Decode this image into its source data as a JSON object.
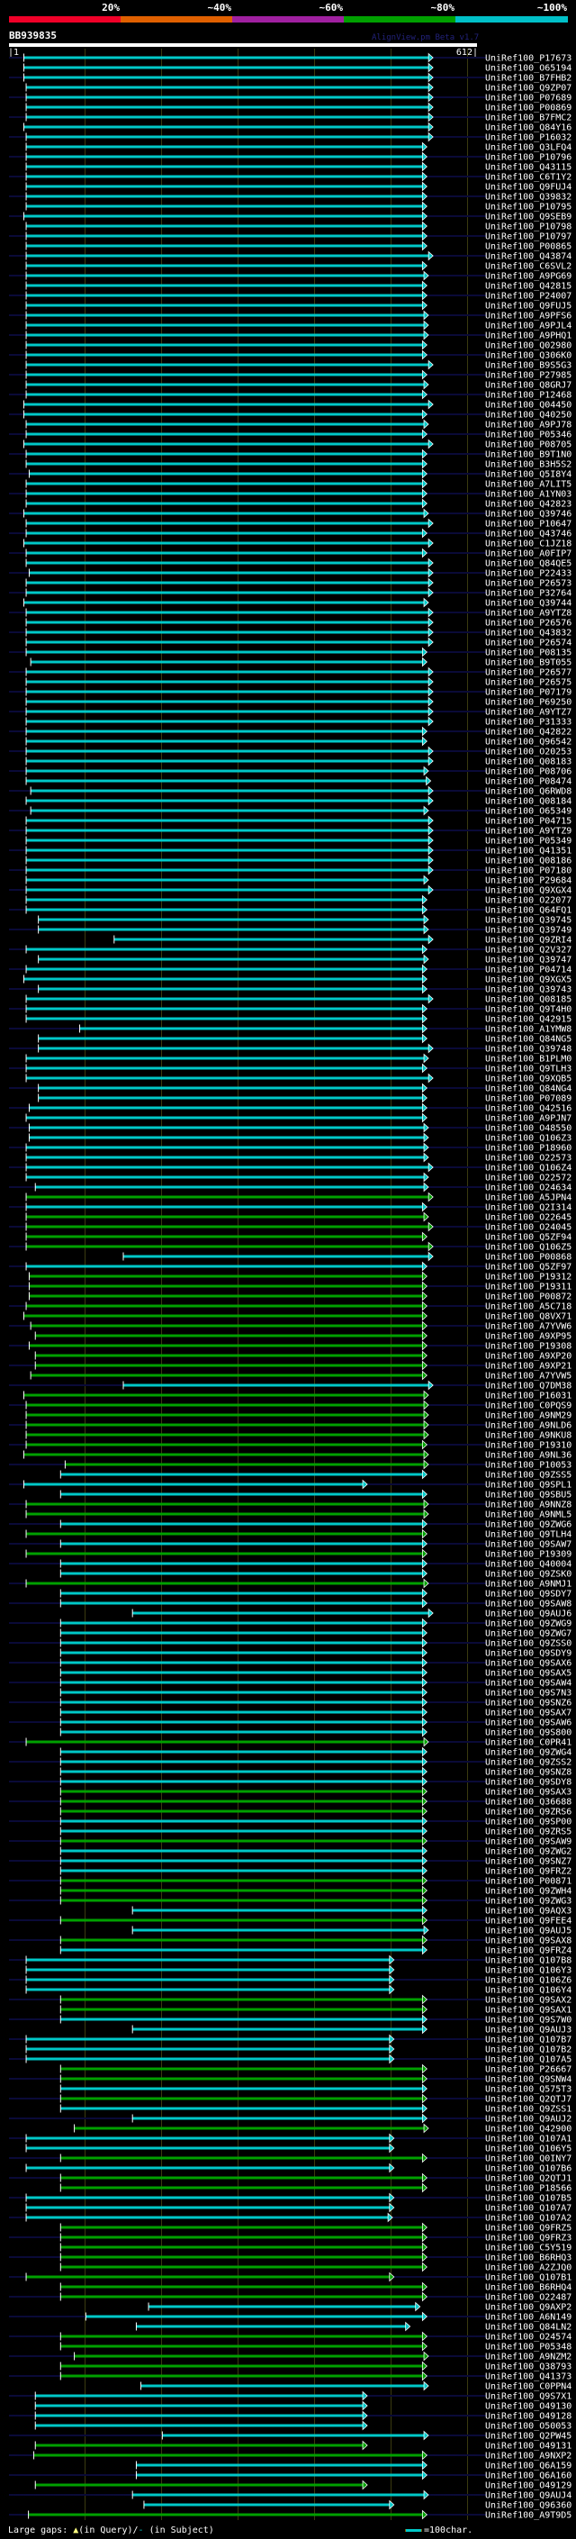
{
  "scale": {
    "labels": [
      "20%",
      "~40%",
      "~60%",
      "~80%",
      "~100%"
    ],
    "colors": [
      "#f00028",
      "#e06000",
      "#a020a0",
      "#00a000",
      "#00c0c8"
    ]
  },
  "query": {
    "name": "BB939835",
    "length_start": "|1",
    "length_end": "612|",
    "version": "AlignView.pm Beta v1.7",
    "length": 612
  },
  "bar_colors": {
    "c": "#00c8c8",
    "g": "#00a000",
    "stripe": "#0a0a38",
    "grid": "#3a3a10"
  },
  "footer": {
    "gaps_prefix": "Large gaps:",
    "gaps_query": "▲",
    "gaps_query_text": "(in Query)/",
    "gaps_subject": "-",
    "gaps_subject_text": " (in Subject)",
    "scale_text": "=100char."
  },
  "rows": [
    [
      "UniRef100_P17673",
      20,
      549,
      "c"
    ],
    [
      "UniRef100_O65194",
      20,
      549,
      "c"
    ],
    [
      "UniRef100_B7FHB2",
      20,
      549,
      "c"
    ],
    [
      "UniRef100_Q9ZP07",
      23,
      549,
      "c"
    ],
    [
      "UniRef100_P07689",
      23,
      549,
      "c"
    ],
    [
      "UniRef100_P00869",
      23,
      549,
      "c"
    ],
    [
      "UniRef100_B7FMC2",
      23,
      549,
      "c"
    ],
    [
      "UniRef100_Q84Y16",
      20,
      549,
      "c"
    ],
    [
      "UniRef100_P16032",
      23,
      549,
      "c"
    ],
    [
      "UniRef100_Q3LFQ4",
      23,
      541,
      "c"
    ],
    [
      "UniRef100_P10796",
      23,
      541,
      "c"
    ],
    [
      "UniRef100_Q43115",
      23,
      541,
      "c"
    ],
    [
      "UniRef100_C6T1Y2",
      23,
      541,
      "c"
    ],
    [
      "UniRef100_Q9FUJ4",
      23,
      541,
      "c"
    ],
    [
      "UniRef100_Q39832",
      23,
      541,
      "c"
    ],
    [
      "UniRef100_P10795",
      23,
      541,
      "c"
    ],
    [
      "UniRef100_Q9SEB9",
      20,
      541,
      "c"
    ],
    [
      "UniRef100_P10798",
      23,
      541,
      "c"
    ],
    [
      "UniRef100_P10797",
      23,
      541,
      "c"
    ],
    [
      "UniRef100_P00865",
      23,
      541,
      "c"
    ],
    [
      "UniRef100_Q43874",
      23,
      549,
      "c"
    ],
    [
      "UniRef100_C6SVL2",
      23,
      541,
      "c"
    ],
    [
      "UniRef100_A9PG69",
      23,
      543,
      "c"
    ],
    [
      "UniRef100_Q42815",
      23,
      541,
      "c"
    ],
    [
      "UniRef100_P24007",
      23,
      541,
      "c"
    ],
    [
      "UniRef100_Q9FUJ5",
      23,
      541,
      "c"
    ],
    [
      "UniRef100_A9PFS6",
      23,
      543,
      "c"
    ],
    [
      "UniRef100_A9PJL4",
      23,
      543,
      "c"
    ],
    [
      "UniRef100_A9PHQ1",
      23,
      543,
      "c"
    ],
    [
      "UniRef100_Q02980",
      23,
      541,
      "c"
    ],
    [
      "UniRef100_Q306K0",
      23,
      541,
      "c"
    ],
    [
      "UniRef100_B9S5G3",
      23,
      549,
      "c"
    ],
    [
      "UniRef100_P27985",
      23,
      541,
      "c"
    ],
    [
      "UniRef100_Q8GRJ7",
      23,
      543,
      "c"
    ],
    [
      "UniRef100_P12468",
      23,
      541,
      "c"
    ],
    [
      "UniRef100_Q04450",
      20,
      549,
      "c"
    ],
    [
      "UniRef100_Q40250",
      20,
      541,
      "c"
    ],
    [
      "UniRef100_A9PJ78",
      23,
      543,
      "c"
    ],
    [
      "UniRef100_P05346",
      23,
      541,
      "c"
    ],
    [
      "UniRef100_P08705",
      20,
      549,
      "c"
    ],
    [
      "UniRef100_B9T1N0",
      23,
      541,
      "c"
    ],
    [
      "UniRef100_B3H5S2",
      23,
      541,
      "c"
    ],
    [
      "UniRef100_Q5I8Y4",
      27,
      541,
      "c"
    ],
    [
      "UniRef100_A7LIT5",
      23,
      541,
      "c"
    ],
    [
      "UniRef100_A1YN03",
      23,
      541,
      "c"
    ],
    [
      "UniRef100_Q42823",
      23,
      541,
      "c"
    ],
    [
      "UniRef100_Q39746",
      20,
      543,
      "c"
    ],
    [
      "UniRef100_P10647",
      23,
      549,
      "c"
    ],
    [
      "UniRef100_Q43746",
      23,
      541,
      "c"
    ],
    [
      "UniRef100_C1JZ18",
      20,
      549,
      "c"
    ],
    [
      "UniRef100_A0FIP7",
      23,
      541,
      "c"
    ],
    [
      "UniRef100_Q84QE5",
      23,
      549,
      "c"
    ],
    [
      "UniRef100_P22433",
      27,
      549,
      "c"
    ],
    [
      "UniRef100_P26573",
      23,
      549,
      "c"
    ],
    [
      "UniRef100_P32764",
      23,
      549,
      "c"
    ],
    [
      "UniRef100_Q39744",
      20,
      543,
      "c"
    ],
    [
      "UniRef100_A9YTZ8",
      23,
      549,
      "c"
    ],
    [
      "UniRef100_P26576",
      23,
      549,
      "c"
    ],
    [
      "UniRef100_Q43832",
      23,
      549,
      "c"
    ],
    [
      "UniRef100_P26574",
      23,
      549,
      "c"
    ],
    [
      "UniRef100_P08135",
      23,
      541,
      "c"
    ],
    [
      "UniRef100_B9T055",
      29,
      541,
      "c"
    ],
    [
      "UniRef100_P26577",
      23,
      549,
      "c"
    ],
    [
      "UniRef100_P26575",
      23,
      549,
      "c"
    ],
    [
      "UniRef100_P07179",
      23,
      549,
      "c"
    ],
    [
      "UniRef100_P69250",
      23,
      549,
      "c"
    ],
    [
      "UniRef100_A9YTZ7",
      23,
      549,
      "c"
    ],
    [
      "UniRef100_P31333",
      23,
      549,
      "c"
    ],
    [
      "UniRef100_Q42822",
      23,
      541,
      "c"
    ],
    [
      "UniRef100_Q96542",
      23,
      541,
      "c"
    ],
    [
      "UniRef100_O20253",
      23,
      549,
      "c"
    ],
    [
      "UniRef100_Q08183",
      23,
      549,
      "c"
    ],
    [
      "UniRef100_P08706",
      23,
      543,
      "c"
    ],
    [
      "UniRef100_P08474",
      23,
      546,
      "c"
    ],
    [
      "UniRef100_Q6RWD8",
      29,
      549,
      "c"
    ],
    [
      "UniRef100_Q08184",
      23,
      549,
      "c"
    ],
    [
      "UniRef100_O65349",
      29,
      543,
      "c"
    ],
    [
      "UniRef100_P04715",
      23,
      549,
      "c"
    ],
    [
      "UniRef100_A9YTZ9",
      23,
      549,
      "c"
    ],
    [
      "UniRef100_P05349",
      23,
      549,
      "c"
    ],
    [
      "UniRef100_Q41351",
      23,
      549,
      "c"
    ],
    [
      "UniRef100_Q08186",
      23,
      549,
      "c"
    ],
    [
      "UniRef100_P07180",
      23,
      549,
      "c"
    ],
    [
      "UniRef100_P29684",
      23,
      543,
      "c"
    ],
    [
      "UniRef100_Q9XGX4",
      23,
      549,
      "c"
    ],
    [
      "UniRef100_O22077",
      23,
      541,
      "c"
    ],
    [
      "UniRef100_Q64FQ1",
      23,
      541,
      "c"
    ],
    [
      "UniRef100_Q39745",
      39,
      543,
      "c"
    ],
    [
      "UniRef100_Q39749",
      39,
      543,
      "c"
    ],
    [
      "UniRef100_Q9ZRI4",
      138,
      549,
      "c"
    ],
    [
      "UniRef100_Q2V327",
      23,
      541,
      "c"
    ],
    [
      "UniRef100_Q39747",
      39,
      543,
      "c"
    ],
    [
      "UniRef100_P04714",
      23,
      541,
      "c"
    ],
    [
      "UniRef100_Q9XGX5",
      20,
      541,
      "c"
    ],
    [
      "UniRef100_Q39743",
      39,
      541,
      "c"
    ],
    [
      "UniRef100_Q08185",
      23,
      549,
      "c"
    ],
    [
      "UniRef100_Q9T4H0",
      23,
      541,
      "c"
    ],
    [
      "UniRef100_Q42915",
      23,
      541,
      "c"
    ],
    [
      "UniRef100_A1YMW8",
      93,
      541,
      "c"
    ],
    [
      "UniRef100_Q84NG5",
      39,
      541,
      "c"
    ],
    [
      "UniRef100_Q39748",
      39,
      549,
      "c"
    ],
    [
      "UniRef100_B1PLM0",
      23,
      543,
      "c"
    ],
    [
      "UniRef100_Q9TLH3",
      23,
      541,
      "c"
    ],
    [
      "UniRef100_Q9XQB5",
      23,
      549,
      "c"
    ],
    [
      "UniRef100_Q84NG4",
      39,
      541,
      "c"
    ],
    [
      "UniRef100_P07089",
      39,
      541,
      "c"
    ],
    [
      "UniRef100_Q42516",
      27,
      541,
      "c"
    ],
    [
      "UniRef100_A9PJN7",
      23,
      541,
      "c"
    ],
    [
      "UniRef100_O48550",
      27,
      543,
      "c"
    ],
    [
      "UniRef100_Q106Z3",
      27,
      543,
      "c"
    ],
    [
      "UniRef100_P18960",
      23,
      543,
      "c"
    ],
    [
      "UniRef100_O22573",
      23,
      543,
      "c"
    ],
    [
      "UniRef100_Q106Z4",
      23,
      549,
      "c"
    ],
    [
      "UniRef100_O22572",
      23,
      543,
      "c"
    ],
    [
      "UniRef100_O24634",
      35,
      543,
      "c"
    ],
    [
      "UniRef100_A5JPN4",
      23,
      549,
      "g"
    ],
    [
      "UniRef100_Q2I314",
      23,
      541,
      "c"
    ],
    [
      "UniRef100_O22645",
      23,
      543,
      "g"
    ],
    [
      "UniRef100_O24045",
      23,
      549,
      "g"
    ],
    [
      "UniRef100_Q5ZF94",
      23,
      541,
      "g"
    ],
    [
      "UniRef100_Q106Z5",
      23,
      549,
      "g"
    ],
    [
      "UniRef100_P00868",
      150,
      549,
      "c"
    ],
    [
      "UniRef100_Q5ZF97",
      23,
      541,
      "c"
    ],
    [
      "UniRef100_P19312",
      27,
      541,
      "g"
    ],
    [
      "UniRef100_P19311",
      27,
      541,
      "g"
    ],
    [
      "UniRef100_P00872",
      27,
      541,
      "g"
    ],
    [
      "UniRef100_A5C718",
      23,
      541,
      "g"
    ],
    [
      "UniRef100_Q8VX71",
      20,
      541,
      "g"
    ],
    [
      "UniRef100_A7YVW6",
      29,
      541,
      "g"
    ],
    [
      "UniRef100_A9XP95",
      35,
      541,
      "g"
    ],
    [
      "UniRef100_P19308",
      27,
      541,
      "g"
    ],
    [
      "UniRef100_A9XP20",
      35,
      541,
      "g"
    ],
    [
      "UniRef100_A9XP21",
      35,
      541,
      "g"
    ],
    [
      "UniRef100_A7YVW5",
      29,
      541,
      "g"
    ],
    [
      "UniRef100_Q7DM38",
      150,
      549,
      "c"
    ],
    [
      "UniRef100_P16031",
      20,
      543,
      "g"
    ],
    [
      "UniRef100_C0PQS9",
      23,
      543,
      "g"
    ],
    [
      "UniRef100_A9NM29",
      23,
      543,
      "g"
    ],
    [
      "UniRef100_A9NLD6",
      23,
      543,
      "g"
    ],
    [
      "UniRef100_A9NKU8",
      23,
      543,
      "g"
    ],
    [
      "UniRef100_P19310",
      23,
      541,
      "g"
    ],
    [
      "UniRef100_A9NL36",
      20,
      543,
      "g"
    ],
    [
      "UniRef100_P10053",
      74,
      543,
      "g"
    ],
    [
      "UniRef100_Q9ZSS5",
      68,
      541,
      "c"
    ],
    [
      "UniRef100_Q9SPL1",
      20,
      463,
      "c"
    ],
    [
      "UniRef100_Q9SBU5",
      68,
      541,
      "c"
    ],
    [
      "UniRef100_A9NNZ8",
      23,
      543,
      "g"
    ],
    [
      "UniRef100_A9NML5",
      23,
      543,
      "g"
    ],
    [
      "UniRef100_Q9ZWG6",
      68,
      541,
      "c"
    ],
    [
      "UniRef100_Q9TLH4",
      23,
      541,
      "g"
    ],
    [
      "UniRef100_Q9SAW7",
      68,
      541,
      "c"
    ],
    [
      "UniRef100_P19309",
      23,
      541,
      "g"
    ],
    [
      "UniRef100_Q40004",
      68,
      541,
      "c"
    ],
    [
      "UniRef100_Q9ZSK0",
      68,
      541,
      "c"
    ],
    [
      "UniRef100_A9NMJ1",
      23,
      543,
      "g"
    ],
    [
      "UniRef100_Q9SDY7",
      68,
      541,
      "c"
    ],
    [
      "UniRef100_Q9SAW8",
      68,
      541,
      "c"
    ],
    [
      "UniRef100_Q9AUJ6",
      162,
      549,
      "c"
    ],
    [
      "UniRef100_Q9ZWG9",
      68,
      541,
      "c"
    ],
    [
      "UniRef100_Q9ZWG7",
      68,
      541,
      "c"
    ],
    [
      "UniRef100_Q9ZSS0",
      68,
      541,
      "c"
    ],
    [
      "UniRef100_Q9SDY9",
      68,
      541,
      "c"
    ],
    [
      "UniRef100_Q9SAX6",
      68,
      541,
      "c"
    ],
    [
      "UniRef100_Q9SAX5",
      68,
      541,
      "c"
    ],
    [
      "UniRef100_Q9SAW4",
      68,
      541,
      "c"
    ],
    [
      "UniRef100_Q9S7N3",
      68,
      541,
      "c"
    ],
    [
      "UniRef100_Q9SNZ6",
      68,
      541,
      "c"
    ],
    [
      "UniRef100_Q9SAX7",
      68,
      541,
      "c"
    ],
    [
      "UniRef100_Q9SAW6",
      68,
      541,
      "c"
    ],
    [
      "UniRef100_Q9S800",
      68,
      541,
      "c"
    ],
    [
      "UniRef100_C0PR41",
      23,
      543,
      "g"
    ],
    [
      "UniRef100_Q9ZWG4",
      68,
      541,
      "c"
    ],
    [
      "UniRef100_Q9ZSS2",
      68,
      541,
      "c"
    ],
    [
      "UniRef100_Q9SNZ8",
      68,
      541,
      "c"
    ],
    [
      "UniRef100_Q9SDY8",
      68,
      541,
      "c"
    ],
    [
      "UniRef100_Q9SAX3",
      68,
      541,
      "g"
    ],
    [
      "UniRef100_Q36688",
      68,
      541,
      "g"
    ],
    [
      "UniRef100_Q9ZRS6",
      68,
      541,
      "g"
    ],
    [
      "UniRef100_Q9SP00",
      68,
      541,
      "c"
    ],
    [
      "UniRef100_Q9ZRS5",
      68,
      541,
      "c"
    ],
    [
      "UniRef100_Q9SAW9",
      68,
      541,
      "g"
    ],
    [
      "UniRef100_Q9ZWG2",
      68,
      541,
      "c"
    ],
    [
      "UniRef100_Q9SNZ7",
      68,
      541,
      "c"
    ],
    [
      "UniRef100_Q9FRZ2",
      68,
      541,
      "c"
    ],
    [
      "UniRef100_P00871",
      68,
      541,
      "g"
    ],
    [
      "UniRef100_Q9ZWH4",
      68,
      541,
      "g"
    ],
    [
      "UniRef100_Q9ZWG3",
      68,
      541,
      "g"
    ],
    [
      "UniRef100_Q9AQX3",
      162,
      541,
      "c"
    ],
    [
      "UniRef100_Q9FEE4",
      68,
      541,
      "g"
    ],
    [
      "UniRef100_Q9AUJ5",
      162,
      543,
      "c"
    ],
    [
      "UniRef100_Q9SAX8",
      68,
      541,
      "g"
    ],
    [
      "UniRef100_Q9FRZ4",
      68,
      541,
      "c"
    ],
    [
      "UniRef100_Q107B8",
      23,
      498,
      "c"
    ],
    [
      "UniRef100_Q106Y3",
      23,
      498,
      "c"
    ],
    [
      "UniRef100_Q106Z6",
      23,
      498,
      "c"
    ],
    [
      "UniRef100_Q106Y4",
      23,
      498,
      "c"
    ],
    [
      "UniRef100_Q9SAX2",
      68,
      541,
      "g"
    ],
    [
      "UniRef100_Q9SAX1",
      68,
      541,
      "g"
    ],
    [
      "UniRef100_Q9S7W0",
      68,
      541,
      "c"
    ],
    [
      "UniRef100_Q9AUJ3",
      162,
      541,
      "c"
    ],
    [
      "UniRef100_Q107B7",
      23,
      498,
      "c"
    ],
    [
      "UniRef100_Q107B2",
      23,
      498,
      "c"
    ],
    [
      "UniRef100_Q107A5",
      23,
      498,
      "c"
    ],
    [
      "UniRef100_P26667",
      68,
      541,
      "g"
    ],
    [
      "UniRef100_Q9SNW4",
      68,
      541,
      "g"
    ],
    [
      "UniRef100_Q575T3",
      68,
      541,
      "c"
    ],
    [
      "UniRef100_Q2QTJ7",
      68,
      541,
      "g"
    ],
    [
      "UniRef100_Q9ZSS1",
      68,
      541,
      "c"
    ],
    [
      "UniRef100_Q9AUJ2",
      162,
      541,
      "c"
    ],
    [
      "UniRef100_Q42900",
      86,
      543,
      "g"
    ],
    [
      "UniRef100_Q107A1",
      23,
      498,
      "c"
    ],
    [
      "UniRef100_Q106Y5",
      23,
      498,
      "c"
    ],
    [
      "UniRef100_Q0INY7",
      68,
      541,
      "g"
    ],
    [
      "UniRef100_Q107B6",
      23,
      498,
      "c"
    ],
    [
      "UniRef100_Q2QTJ1",
      68,
      541,
      "g"
    ],
    [
      "UniRef100_P18566",
      68,
      541,
      "g"
    ],
    [
      "UniRef100_Q107B5",
      23,
      498,
      "c"
    ],
    [
      "UniRef100_Q107A7",
      23,
      498,
      "c"
    ],
    [
      "UniRef100_Q107A2",
      23,
      496,
      "c"
    ],
    [
      "UniRef100_Q9FRZ5",
      68,
      541,
      "g"
    ],
    [
      "UniRef100_Q9FRZ3",
      68,
      541,
      "g"
    ],
    [
      "UniRef100_C5Y519",
      68,
      541,
      "g"
    ],
    [
      "UniRef100_B6RHQ3",
      68,
      541,
      "g"
    ],
    [
      "UniRef100_A2ZJQ0",
      68,
      541,
      "g"
    ],
    [
      "UniRef100_Q107B1",
      23,
      498,
      "g"
    ],
    [
      "UniRef100_B6RHQ4",
      68,
      541,
      "g"
    ],
    [
      "UniRef100_O22487",
      68,
      541,
      "g"
    ],
    [
      "UniRef100_Q9AXP2",
      183,
      532,
      "c"
    ],
    [
      "UniRef100_A6N149",
      101,
      541,
      "c"
    ],
    [
      "UniRef100_Q84LN2",
      167,
      519,
      "c"
    ],
    [
      "UniRef100_O24574",
      68,
      541,
      "g"
    ],
    [
      "UniRef100_P05348",
      68,
      541,
      "g"
    ],
    [
      "UniRef100_A9NZM2",
      86,
      543,
      "g"
    ],
    [
      "UniRef100_Q38793",
      68,
      541,
      "g"
    ],
    [
      "UniRef100_Q41373",
      68,
      541,
      "g"
    ],
    [
      "UniRef100_C0PPN4",
      173,
      543,
      "c"
    ],
    [
      "UniRef100_Q9S7X1",
      35,
      463,
      "c"
    ],
    [
      "UniRef100_O49130",
      35,
      463,
      "c"
    ],
    [
      "UniRef100_O49128",
      35,
      463,
      "c"
    ],
    [
      "UniRef100_O50053",
      35,
      463,
      "c"
    ],
    [
      "UniRef100_Q2PW45",
      201,
      543,
      "c"
    ],
    [
      "UniRef100_O49131",
      35,
      463,
      "g"
    ],
    [
      "UniRef100_A9NXP2",
      33,
      541,
      "g"
    ],
    [
      "UniRef100_Q6A159",
      167,
      541,
      "c"
    ],
    [
      "UniRef100_Q6A160",
      167,
      541,
      "c"
    ],
    [
      "UniRef100_O49129",
      35,
      463,
      "g"
    ],
    [
      "UniRef100_Q9AUJ4",
      162,
      543,
      "c"
    ],
    [
      "UniRef100_Q96360",
      177,
      498,
      "c"
    ],
    [
      "UniRef100_A9T9D5",
      26,
      541,
      "g"
    ]
  ]
}
